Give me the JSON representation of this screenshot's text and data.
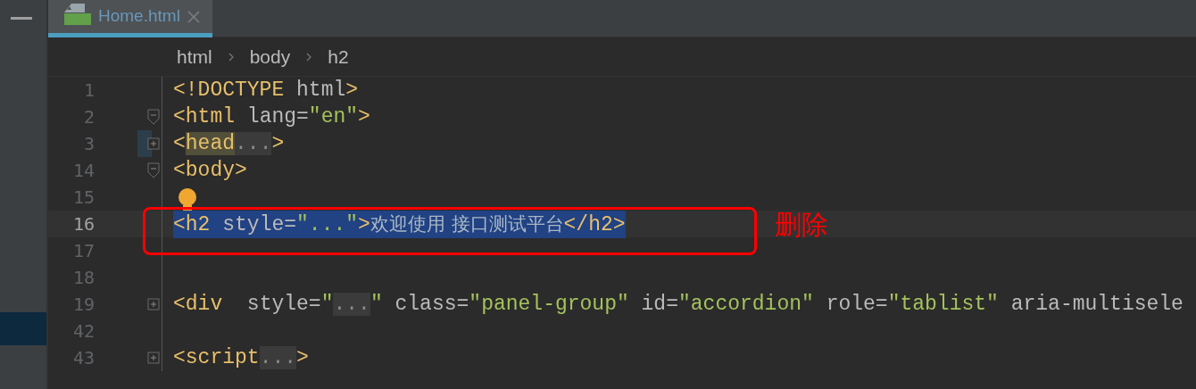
{
  "tabs": [
    {
      "label": "Home.html",
      "selected": true
    }
  ],
  "breadcrumbs": [
    "html",
    "body",
    "h2"
  ],
  "lines": [
    {
      "number": "1",
      "tokens": [
        {
          "kind": "tag",
          "text": "<!DOCTYPE "
        },
        {
          "kind": "attr",
          "text": "html"
        },
        {
          "kind": "tag",
          "text": ">"
        }
      ]
    },
    {
      "number": "2",
      "expanded": true,
      "tokens": [
        {
          "kind": "tag",
          "text": "<html "
        },
        {
          "kind": "attr",
          "text": "lang="
        },
        {
          "kind": "str",
          "text": "\"en\""
        },
        {
          "kind": "tag",
          "text": ">"
        }
      ]
    },
    {
      "number": "3",
      "expanded": false,
      "marked": true,
      "tokens": [
        {
          "kind": "tag",
          "text": "<"
        },
        {
          "kind": "match",
          "text": "head"
        },
        {
          "kind": "folded",
          "text": "..."
        },
        {
          "kind": "tag",
          "text": ">"
        }
      ]
    },
    {
      "number": "14",
      "expanded": true,
      "tokens": [
        {
          "kind": "tag",
          "text": "<body>"
        }
      ]
    },
    {
      "number": "15",
      "hint": true
    },
    {
      "number": "16",
      "selected": true,
      "tokens": [
        {
          "kind": "tag",
          "text": "<h2 "
        },
        {
          "kind": "attr",
          "text": "style="
        },
        {
          "kind": "str",
          "text": "\"...\""
        },
        {
          "kind": "tag",
          "text": ">"
        },
        {
          "kind": "text",
          "text": "欢迎使用 接口测试平台"
        },
        {
          "kind": "tag",
          "text": "</h2>"
        }
      ]
    },
    {
      "number": "17"
    },
    {
      "number": "18"
    },
    {
      "number": "19",
      "expanded": false,
      "tokens": [
        {
          "kind": "tag",
          "text": "<div  "
        },
        {
          "kind": "attr",
          "text": "style="
        },
        {
          "kind": "str",
          "text": "\""
        },
        {
          "kind": "folded",
          "text": "..."
        },
        {
          "kind": "str",
          "text": "\" "
        },
        {
          "kind": "attr",
          "text": "class="
        },
        {
          "kind": "str",
          "text": "\"panel-group\" "
        },
        {
          "kind": "attr",
          "text": "id="
        },
        {
          "kind": "str",
          "text": "\"accordion\" "
        },
        {
          "kind": "attr",
          "text": "role="
        },
        {
          "kind": "str",
          "text": "\"tablist\" "
        },
        {
          "kind": "attr",
          "text": "aria-multisele"
        }
      ]
    },
    {
      "number": "42"
    },
    {
      "number": "43",
      "expanded": false,
      "tokens": [
        {
          "kind": "tag",
          "text": "<script"
        },
        {
          "kind": "folded",
          "text": "..."
        },
        {
          "kind": "tag",
          "text": ">"
        }
      ]
    }
  ],
  "annotation": {
    "label": "删除"
  }
}
